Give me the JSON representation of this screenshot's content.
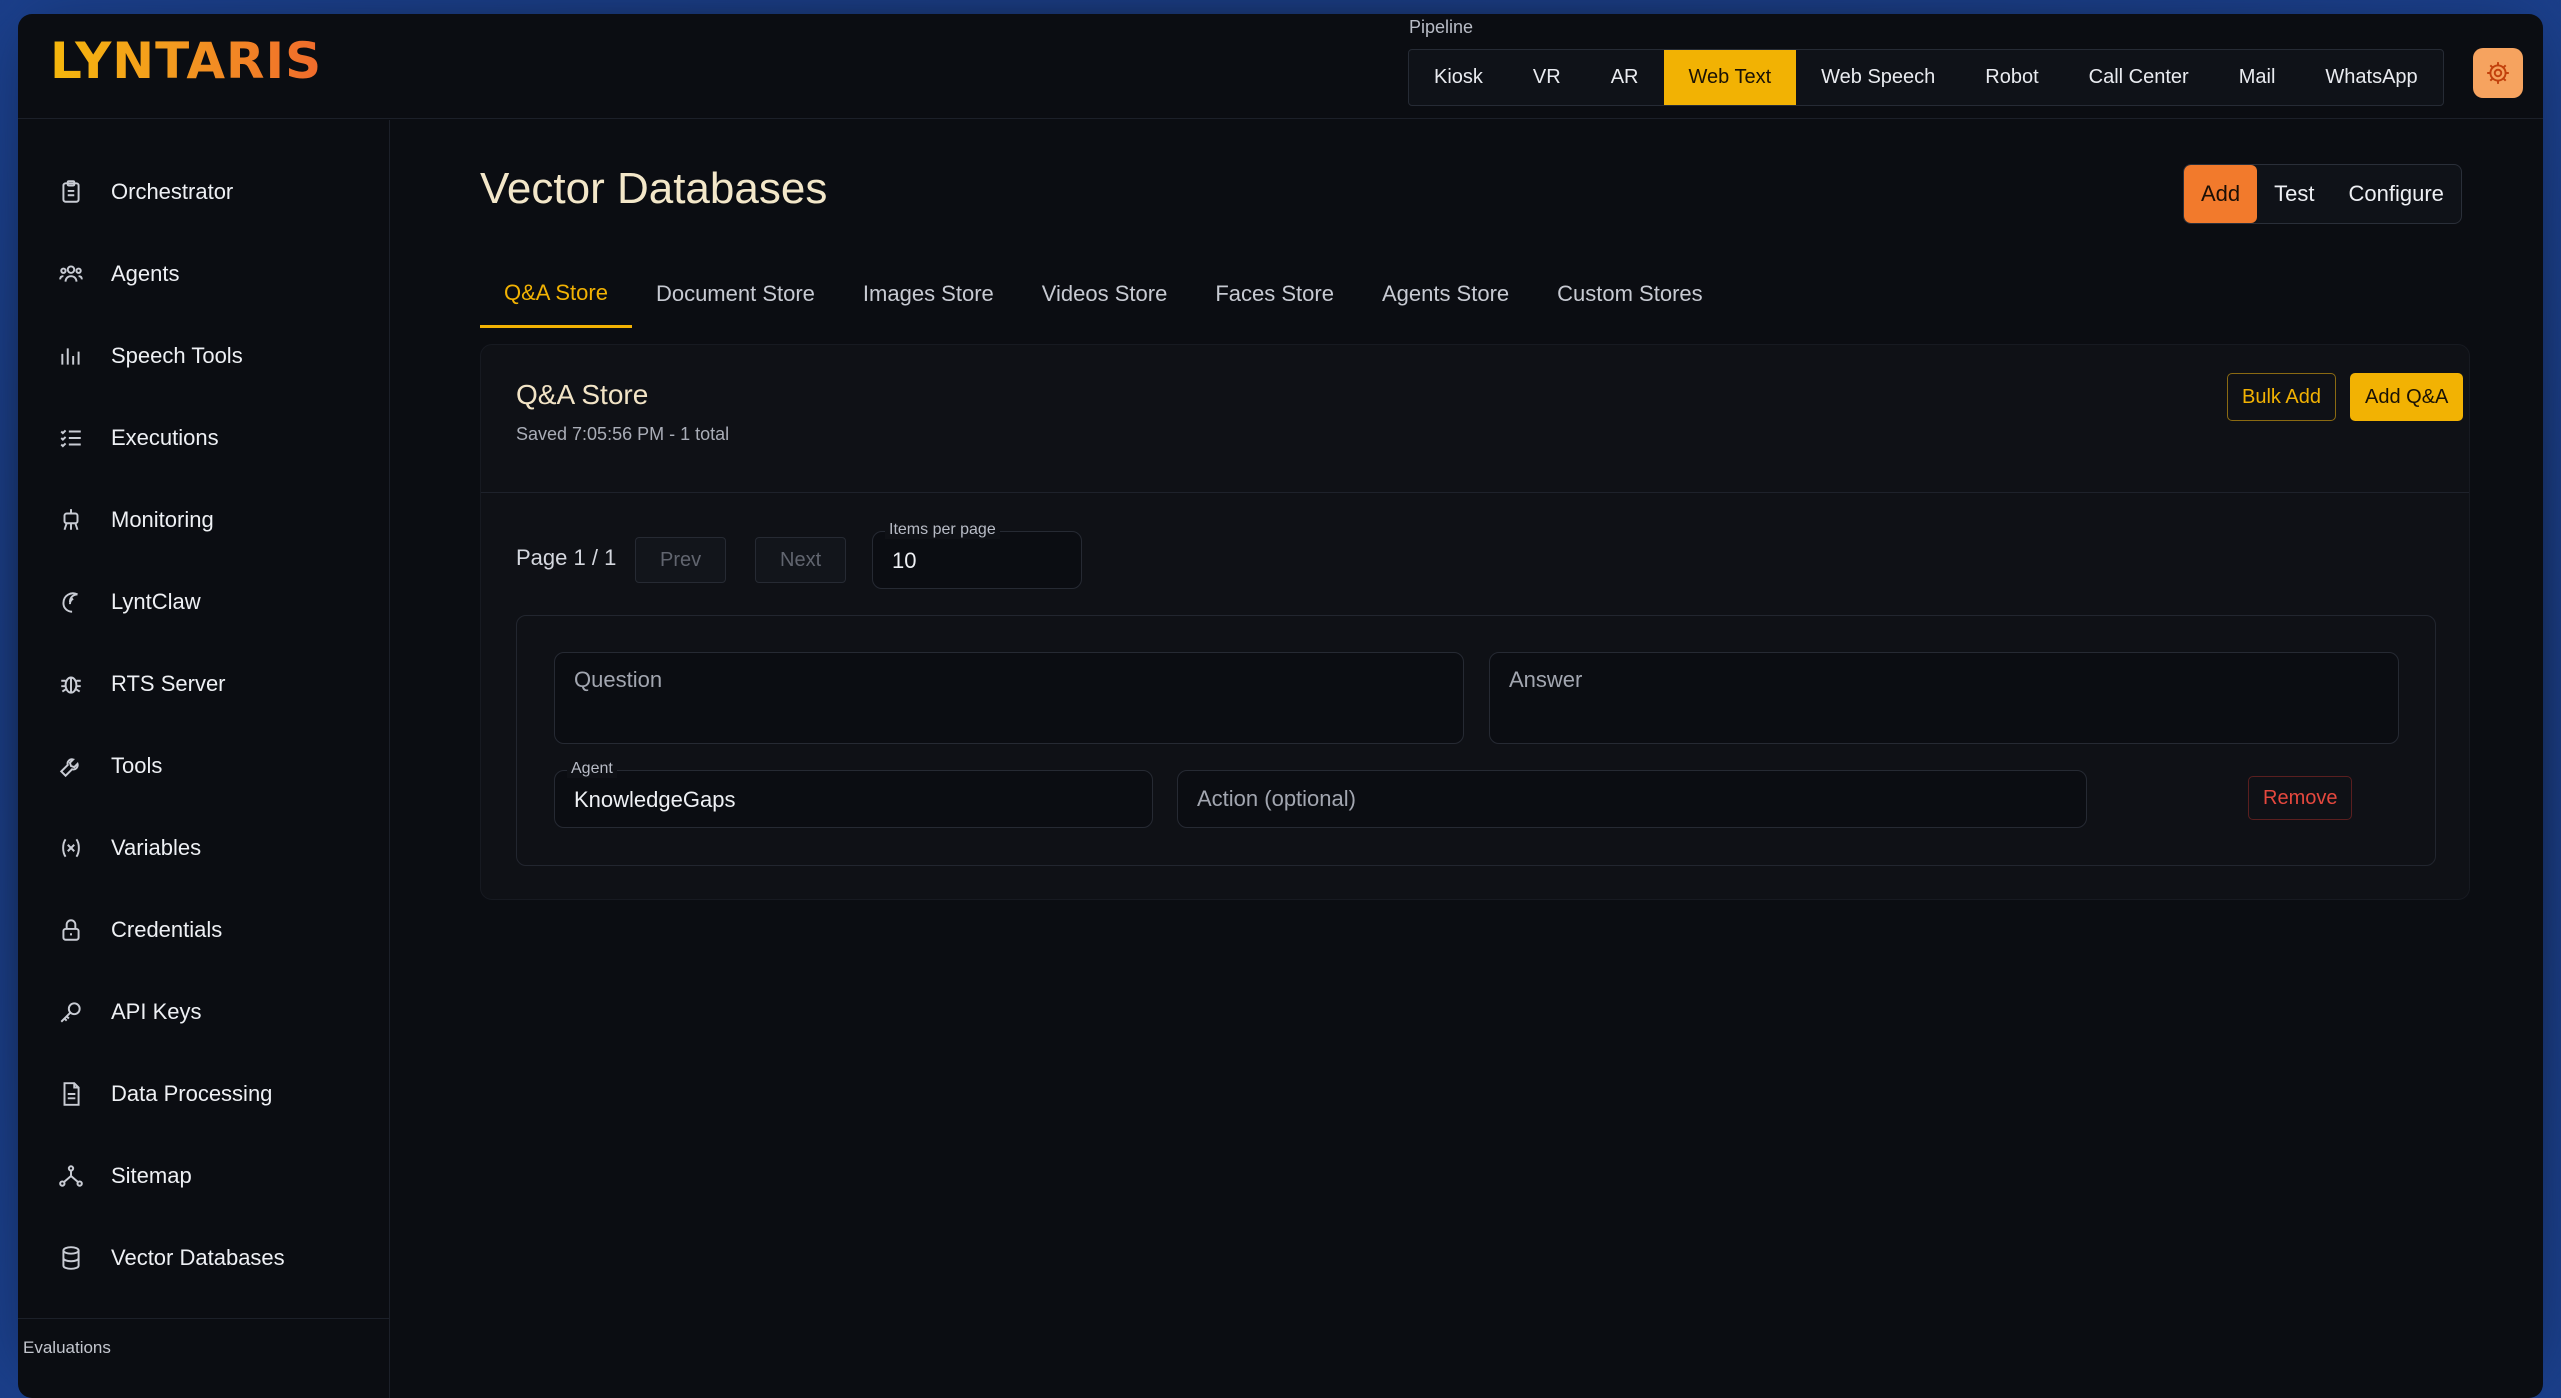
{
  "app": {
    "logo": "LYNTARIS"
  },
  "header": {
    "pipeline_label": "Pipeline",
    "pipeline": [
      "Kiosk",
      "VR",
      "AR",
      "Web Text",
      "Web Speech",
      "Robot",
      "Call Center",
      "Mail",
      "WhatsApp"
    ],
    "pipeline_active": "Web Text",
    "settings_icon": "gear-icon"
  },
  "sidebar": {
    "items": [
      {
        "label": "Orchestrator",
        "icon": "clipboard-icon"
      },
      {
        "label": "Agents",
        "icon": "users-icon"
      },
      {
        "label": "Speech Tools",
        "icon": "bar-chart-icon"
      },
      {
        "label": "Executions",
        "icon": "list-check-icon"
      },
      {
        "label": "Monitoring",
        "icon": "robot-icon"
      },
      {
        "label": "LyntClaw",
        "icon": "claw-icon"
      },
      {
        "label": "RTS Server",
        "icon": "bug-icon"
      },
      {
        "label": "Tools",
        "icon": "wrench-icon"
      },
      {
        "label": "Variables",
        "icon": "variable-icon"
      },
      {
        "label": "Credentials",
        "icon": "lock-icon"
      },
      {
        "label": "API Keys",
        "icon": "key-icon"
      },
      {
        "label": "Data Processing",
        "icon": "file-icon"
      },
      {
        "label": "Sitemap",
        "icon": "sitemap-icon"
      },
      {
        "label": "Vector Databases",
        "icon": "database-icon"
      }
    ],
    "section_label": "Evaluations"
  },
  "main": {
    "title": "Vector Databases",
    "actions": [
      "Add",
      "Test",
      "Configure"
    ],
    "active_action": "Add",
    "tabs": [
      "Q&A Store",
      "Document Store",
      "Images Store",
      "Videos Store",
      "Faces Store",
      "Agents Store",
      "Custom Stores"
    ],
    "active_tab": "Q&A Store"
  },
  "card": {
    "title": "Q&A Store",
    "subtitle": "Saved 7:05:56 PM - 1 total",
    "bulk_add": "Bulk Add",
    "add_qa": "Add Q&A",
    "pager": {
      "text": "Page 1 / 1",
      "prev": "Prev",
      "next": "Next",
      "items_label": "Items per page",
      "items_value": "10"
    },
    "entry": {
      "question_placeholder": "Question",
      "answer_placeholder": "Answer",
      "agent_label": "Agent",
      "agent_value": "KnowledgeGaps",
      "action_placeholder": "Action (optional)",
      "remove": "Remove"
    }
  },
  "colors": {
    "accent": "#f2b203",
    "orange": "#f27a2c",
    "danger": "#e5483e",
    "bg": "#0b0d12"
  }
}
